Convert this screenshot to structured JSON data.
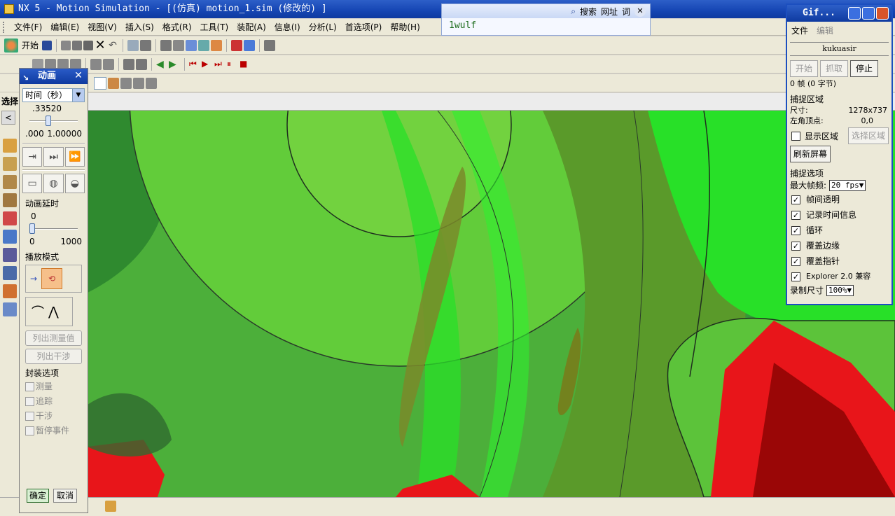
{
  "window": {
    "title": "NX 5 - Motion Simulation - [(仿真) motion_1.sim (修改的) ]"
  },
  "menu": [
    "文件(F)",
    "编辑(E)",
    "视图(V)",
    "插入(S)",
    "格式(R)",
    "工具(T)",
    "装配(A)",
    "信息(I)",
    "分析(L)",
    "首选项(P)",
    "帮助(H)"
  ],
  "toolbar": {
    "start_label": "开始"
  },
  "resource": {
    "label": "选择"
  },
  "search": {
    "search_label": "搜索",
    "url_label": "网址",
    "word_label": "词",
    "query": "1wulf"
  },
  "animation": {
    "title": "动画",
    "time_select": "时间（秒）",
    "time_value": ".33520",
    "time_fraction": 0.335,
    "time_min": ".000",
    "time_max": "1.00000",
    "delay_label": "动画延时",
    "delay_value": "0",
    "delay_min": "0",
    "delay_max": "1000",
    "play_mode_label": "播放模式",
    "list_measure": "列出测量值",
    "list_interference": "列出干涉",
    "envelope_label": "封装选项",
    "options": [
      "测量",
      "追踪",
      "干涉",
      "暂停事件"
    ],
    "ok": "确定",
    "cancel": "取消"
  },
  "gif": {
    "title": "Gif...",
    "menu": [
      "文件",
      "编辑"
    ],
    "user": "kukuasir",
    "buttons": {
      "start": "开始",
      "capture": "抓取",
      "stop": "停止"
    },
    "frames": "0 帧 (0 字节)",
    "capture_area_label": "捕捉区域",
    "size_label": "尺寸:",
    "size_value": "1278x737",
    "corner_label": "左角顶点:",
    "corner_value": "0,0",
    "show_area": "显示区域",
    "select_area": "选择区域",
    "refresh": "刷新屏幕",
    "options_label": "捕捉选项",
    "max_fps_label": "最大帧频:",
    "max_fps_value": "20 fps",
    "checks": [
      "帧间透明",
      "记录时间信息",
      "循环",
      "覆盖边缘",
      "覆盖指针",
      "Explorer 2.0 兼容"
    ],
    "rec_size_label": "录制尺寸",
    "rec_size_value": "100%"
  },
  "colors": {
    "green_dark": "#2f8a2f",
    "green_mid": "#5ec93a",
    "green_bright": "#28e028",
    "red": "#e8151a",
    "red_dark": "#9a0606",
    "olive": "#7a8a2a"
  }
}
